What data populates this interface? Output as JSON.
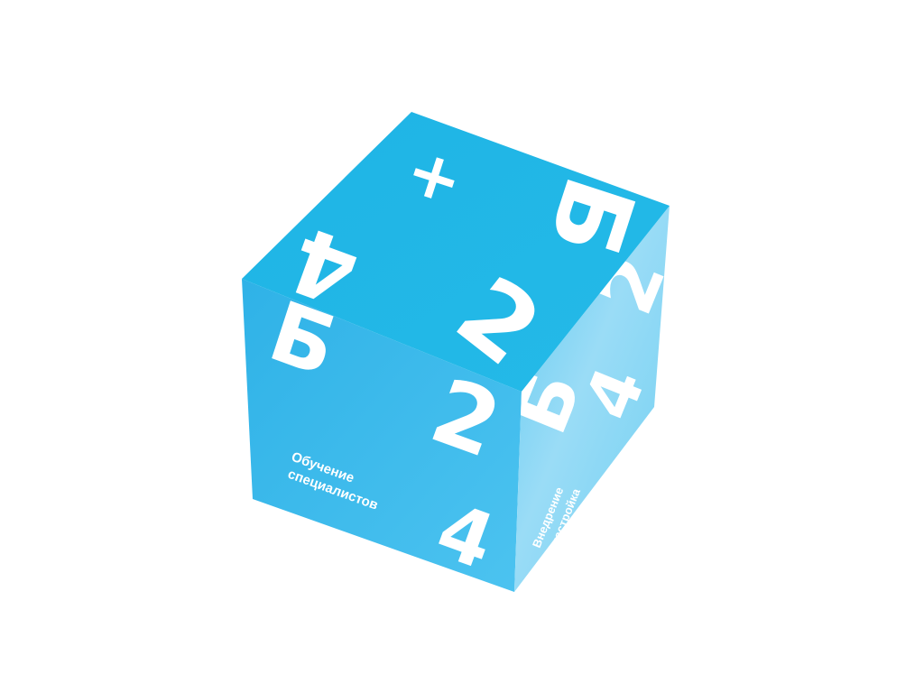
{
  "colors": {
    "top_face": "#21B7E6",
    "left_face": "#34B8EA",
    "right_face_light": "#8FD7F3",
    "right_face_dark": "#45BDEC",
    "glyph": "#FFFFFF",
    "background": "#FFFFFF"
  },
  "top_face": {
    "glyph_plus": "+",
    "glyph_be": "Б",
    "glyph_four": "4",
    "glyph_two": "2"
  },
  "left_face": {
    "glyph_be": "Б",
    "glyph_two": "2",
    "glyph_four": "4",
    "caption_line1": "Обучение",
    "caption_line2": "специалистов"
  },
  "right_face": {
    "glyph_two": "2",
    "glyph_be": "Б",
    "glyph_four": "4",
    "caption_line1": "Внедрение",
    "caption_line2": "и настройка"
  }
}
